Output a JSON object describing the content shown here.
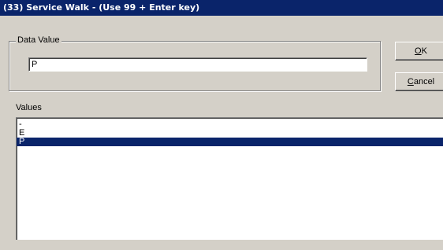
{
  "window": {
    "title": "(33) Service Walk - (Use 99 + Enter key)"
  },
  "data_value": {
    "group_label": "Data Value",
    "value": "P"
  },
  "buttons": {
    "ok_label": "OK",
    "cancel_label": "Cancel"
  },
  "values": {
    "label": "Values",
    "items": [
      "-",
      "E",
      "P"
    ],
    "selected": "P"
  },
  "colors": {
    "titlebar": "#0a246a",
    "selection": "#0a246a",
    "face": "#d4d0c8"
  }
}
